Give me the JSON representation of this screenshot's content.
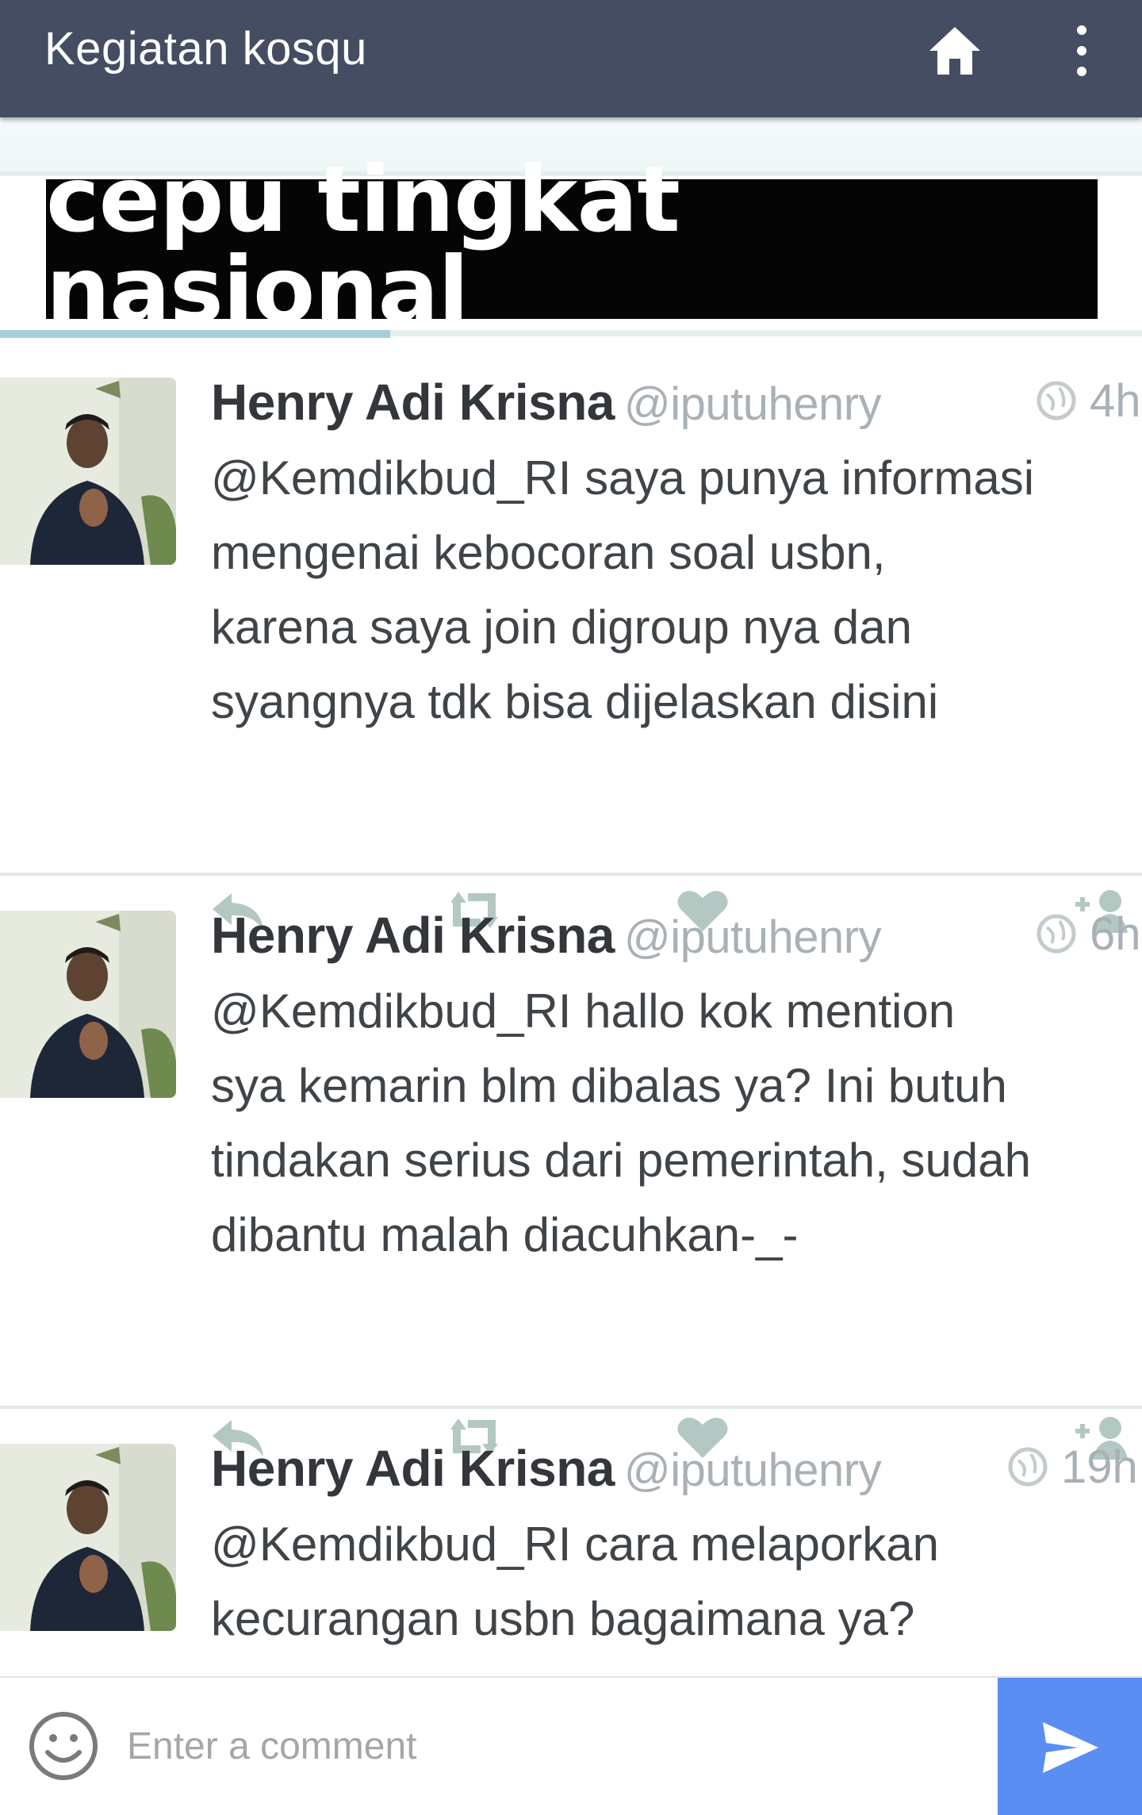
{
  "appbar": {
    "title": "Kegiatan kosqu",
    "home_icon": "home-icon",
    "more_icon": "more-vert-icon",
    "background": "#454d63"
  },
  "post": {
    "banner_text": "cepu tingkat nasional",
    "tweets": [
      {
        "name": "Henry Adi Krisna",
        "handle": "@iputuhenry",
        "time": "4h",
        "text": "@Kemdikbud_RI saya punya informasi\nmengenai kebocoran soal usbn,\nkarena saya join digroup nya dan\nsyangnya tdk bisa dijelaskan disini"
      },
      {
        "name": "Henry Adi Krisna",
        "handle": "@iputuhenry",
        "time": "6h",
        "text": "@Kemdikbud_RI hallo kok mention\nsya kemarin blm dibalas ya? Ini butuh\ntindakan serius dari pemerintah, sudah\ndibantu malah diacuhkan-_-"
      },
      {
        "name": "Henry Adi Krisna",
        "handle": "@iputuhenry",
        "time": "19h",
        "text": "@Kemdikbud_RI cara melaporkan\nkecurangan usbn bagaimana ya?"
      }
    ]
  },
  "comment_bar": {
    "placeholder": "Enter a comment",
    "emoji_icon": "smiley-icon",
    "send_icon": "send-icon",
    "send_color": "#5b8ef2"
  }
}
